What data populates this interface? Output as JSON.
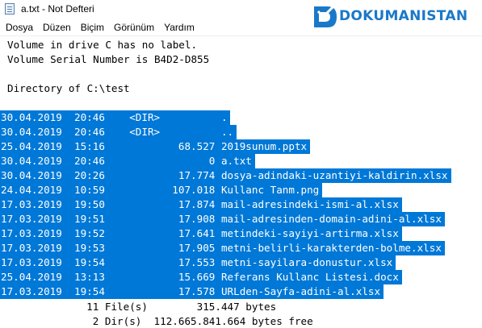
{
  "window": {
    "title": "a.txt - Not Defteri"
  },
  "logo": {
    "text": "DOKUMANISTAN",
    "color": "#1a78c9"
  },
  "menu": [
    {
      "label": "Dosya"
    },
    {
      "label": "Düzen"
    },
    {
      "label": "Biçim"
    },
    {
      "label": "Görünüm"
    },
    {
      "label": "Yardım"
    }
  ],
  "header_lines": [
    "Volume in drive C has no label.",
    "Volume Serial Number is B4D2-D855",
    "",
    "Directory of C:\\test"
  ],
  "selection_color": "#0078d7",
  "listing": [
    {
      "text": "30.04.2019  20:46    <DIR>          ."
    },
    {
      "text": "30.04.2019  20:46    <DIR>          .."
    },
    {
      "text": "25.04.2019  15:16            68.527 2019sunum.pptx"
    },
    {
      "text": "30.04.2019  20:46                 0 a.txt"
    },
    {
      "text": "30.04.2019  20:26            17.774 dosya-adindaki-uzantiyi-kaldirin.xlsx"
    },
    {
      "text": "24.04.2019  10:59           107.018 Kullanc Tanm.png"
    },
    {
      "text": "17.03.2019  19:50            17.874 mail-adresindeki-ismi-al.xlsx"
    },
    {
      "text": "17.03.2019  19:51            17.908 mail-adresinden-domain-adini-al.xlsx"
    },
    {
      "text": "17.03.2019  19:52            17.641 metindeki-sayiyi-artirma.xlsx"
    },
    {
      "text": "17.03.2019  19:53            17.905 metni-belirli-karakterden-bolme.xlsx"
    },
    {
      "text": "17.03.2019  19:54            17.553 metni-sayilara-donustur.xlsx"
    },
    {
      "text": "25.04.2019  13:13            15.669 Referans Kullanc Listesi.docx"
    },
    {
      "text": "17.03.2019  19:54            17.578 URLden-Sayfa-adini-al.xlsx"
    }
  ],
  "summary": [
    "              11 File(s)        315.447 bytes",
    "               2 Dir(s)  112.665.841.664 bytes free"
  ]
}
